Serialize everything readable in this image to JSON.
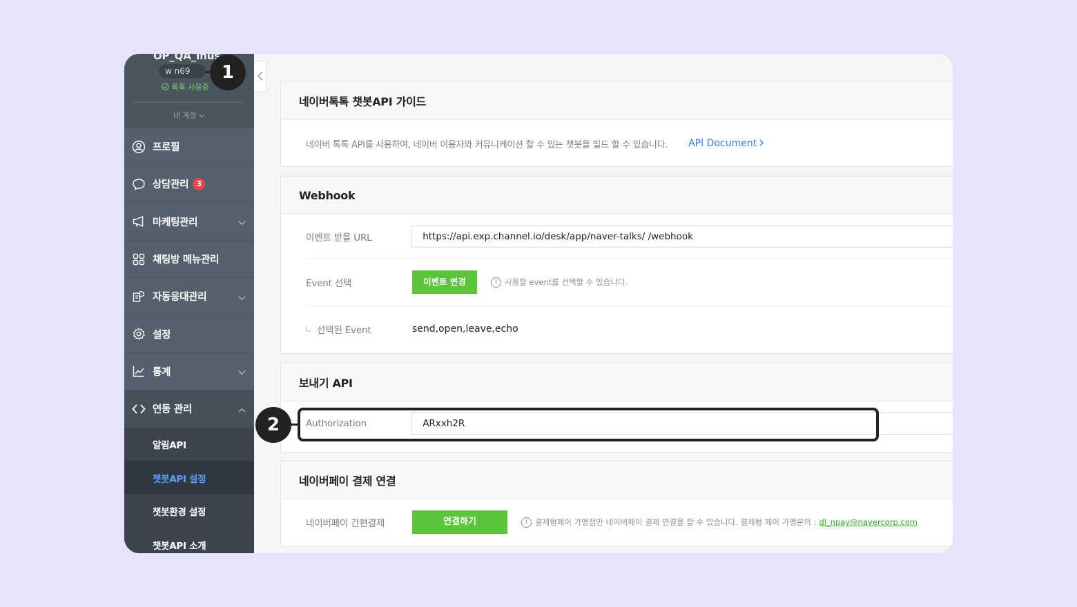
{
  "sidebar": {
    "account_name": "OP_QA_Inus",
    "account_id": "w   n69",
    "status": "톡톡 사용중",
    "my_account": "내 계정",
    "menu": [
      {
        "label": "프로필",
        "icon": "person-icon"
      },
      {
        "label": "상담관리",
        "icon": "chat-bubble-icon",
        "badge": "3"
      },
      {
        "label": "마케팅관리",
        "icon": "megaphone-icon"
      },
      {
        "label": "채팅방 메뉴관리",
        "icon": "grid-icon"
      },
      {
        "label": "자동응대관리",
        "icon": "auto-reply-icon"
      },
      {
        "label": "설정",
        "icon": "gear-icon"
      },
      {
        "label": "통계",
        "icon": "line-chart-icon"
      },
      {
        "label": "연동 관리",
        "icon": "code-icon"
      }
    ],
    "submenu": [
      {
        "label": "알림API"
      },
      {
        "label": "챗봇API 설정"
      },
      {
        "label": "챗봇환경 설정"
      },
      {
        "label": "챗봇API 소개"
      }
    ]
  },
  "guide": {
    "title": "네이버톡톡 챗봇API 가이드",
    "description": "네이버 톡톡 API를 사용하여, 네이버 이용자와 커뮤니케이션 할 수 있는 챗봇을 빌드 할 수 있습니다.",
    "doc_link": "API Document"
  },
  "webhook": {
    "title": "Webhook",
    "url_label": "이벤트 받을 URL",
    "url_value": "https://api.exp.channel.io/desk/app/naver-talks/  /webhook",
    "event_label": "Event 선택",
    "event_button": "이벤트 변경",
    "event_hint": "사용할 event를 선택할 수 있습니다.",
    "selected_label": "선택된 Event",
    "selected_value": "send,open,leave,echo"
  },
  "sender": {
    "title": "보내기 API",
    "auth_label": "Authorization",
    "auth_value": "ARxxh2R"
  },
  "naverpay": {
    "title": "네이버페이 결제 연결",
    "label": "네이버페이 간편결제",
    "button": "연결하기",
    "hint": "결제형페이 가맹점만 네이버페이 결제 연결을 할 수 있습니다. 결제형 페이 가맹문의 :",
    "email": "dl_npay@navercorp.com"
  },
  "callouts": {
    "one": "1",
    "two": "2"
  },
  "colors": {
    "accent_green": "#5ac53a",
    "link_blue": "#3d7be0",
    "sidebar_bg": "#54606b",
    "background": "#e6e4fb"
  }
}
